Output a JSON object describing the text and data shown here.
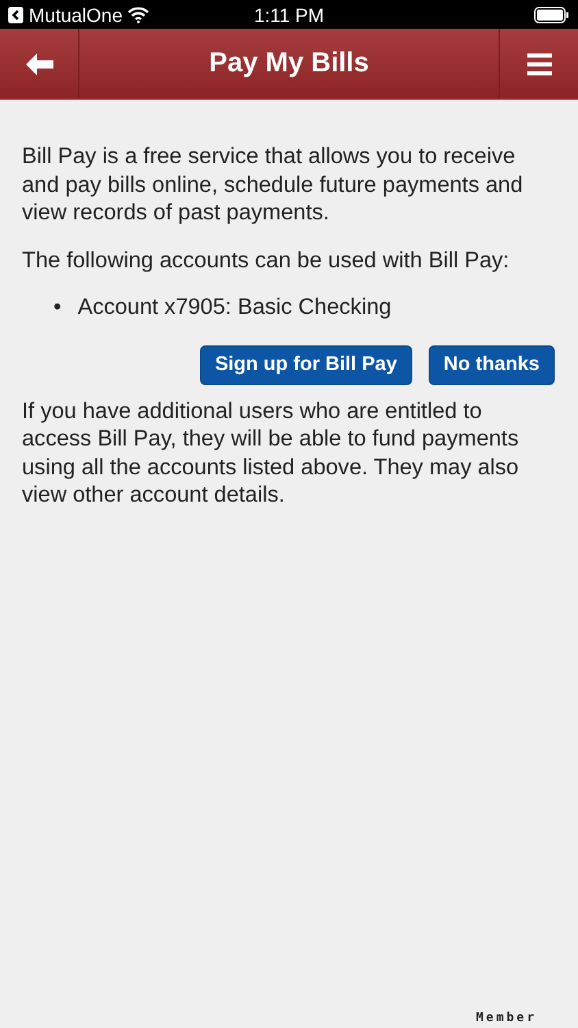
{
  "status_bar": {
    "back_app": "MutualOne",
    "time": "1:11 PM"
  },
  "header": {
    "title": "Pay My Bills"
  },
  "intro": "Bill Pay is a free service that allows you to receive and pay bills online, schedule future payments and view records of past payments.",
  "accounts_heading": "The following accounts can be used with Bill Pay:",
  "accounts": [
    {
      "bullet": "•",
      "text": "Account x7905: Basic Checking"
    }
  ],
  "buttons": [
    {
      "label": "Sign up for Bill Pay"
    },
    {
      "label": "No thanks"
    }
  ],
  "note": "If you have additional users who are entitled to access Bill Pay, they will be able to fund payments using all the accounts listed above. They may also view other account details.",
  "footer": {
    "member": "Member"
  }
}
